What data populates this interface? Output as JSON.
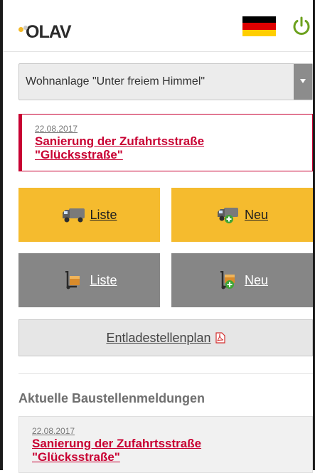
{
  "header": {
    "logo_text": "OLAV",
    "flag_colors": [
      "#000000",
      "#dd0000",
      "#ffce00"
    ],
    "flag_icon": "flag-germany-icon",
    "power_icon": "power-icon"
  },
  "select": {
    "value": "Wohnanlage \"Unter freiem Himmel\""
  },
  "top_notice": {
    "date": "22.08.2017",
    "title": "Sanierung der Zufahrtsstraße \"Glücksstraße\""
  },
  "tiles": [
    {
      "label": "Liste",
      "icon": "truck-icon"
    },
    {
      "label": "Neu",
      "icon": "truck-add-icon"
    },
    {
      "label": "Liste",
      "icon": "hand-truck-icon"
    },
    {
      "label": "Neu",
      "icon": "hand-truck-add-icon"
    }
  ],
  "plan_button": {
    "label": "Entladestellenplan",
    "icon": "pdf-icon"
  },
  "section": {
    "title": "Aktuelle Baustellenmeldungen"
  },
  "bottom_notice": {
    "date": "22.08.2017",
    "title": "Sanierung der Zufahrtsstraße \"Glücksstraße\""
  },
  "colors": {
    "accent_red": "#c80032",
    "tile_yellow": "#f5bb2e",
    "tile_grey": "#868686",
    "power_green": "#6ca11e"
  }
}
